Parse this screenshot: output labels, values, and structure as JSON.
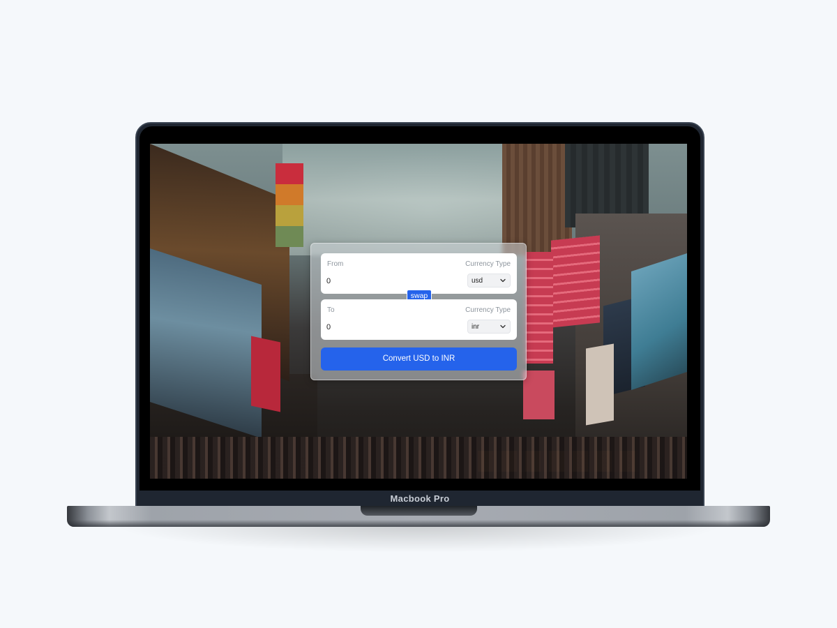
{
  "device": {
    "label": "Macbook Pro"
  },
  "converter": {
    "from": {
      "label": "From",
      "type_label": "Currency Type",
      "amount": "0",
      "currency": "usd"
    },
    "to": {
      "label": "To",
      "type_label": "Currency Type",
      "amount": "0",
      "currency": "inr"
    },
    "swap_label": "swap",
    "convert_label": "Convert USD to INR"
  },
  "icons": {
    "select_arrow": "chevron-down-icon"
  },
  "colors": {
    "accent": "#2563eb",
    "page_background": "#f5f8fb"
  }
}
